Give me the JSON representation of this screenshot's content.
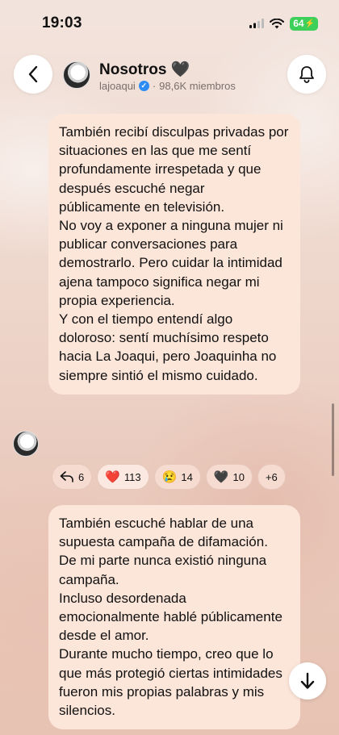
{
  "status_bar": {
    "time": "19:03",
    "battery": "64"
  },
  "header": {
    "title": "Nosotros",
    "title_emoji": "🖤",
    "creator": "lajoaqui",
    "separator": "·",
    "members": "98,6K miembros"
  },
  "messages": [
    {
      "paragraphs": [
        "También recibí disculpas privadas por situaciones en las que me sentí profundamente irrespetada y que después escuché negar públicamente en televisión.",
        "No voy a exponer a ninguna mujer ni publicar conversaciones para demostrarlo. Pero cuidar la intimidad ajena tampoco significa negar mi propia experiencia.",
        "Y con el tiempo entendí algo doloroso: sentí muchísimo respeto hacia La Joaqui, pero Joaquinha no siempre sintió el mismo cuidado."
      ]
    },
    {
      "paragraphs": [
        "También escuché hablar de una supuesta campaña de difamación.",
        "De mi parte nunca existió ninguna campaña.",
        "Incluso desordenada emocionalmente hablé públicamente desde el amor.",
        "Durante mucho tiempo, creo que lo que más protegió ciertas intimidades fueron mis propias palabras y mis silencios."
      ]
    }
  ],
  "reactions": [
    {
      "icon": "reply-icon",
      "glyph": "↶",
      "count": "6"
    },
    {
      "icon": "red-heart-emoji",
      "glyph": "❤️",
      "count": "113"
    },
    {
      "icon": "sad-face-emoji",
      "glyph": "😢",
      "count": "14"
    },
    {
      "icon": "black-heart-emoji",
      "glyph": "🖤",
      "count": "10"
    },
    {
      "icon": "more-reactions",
      "glyph": "",
      "count": "+6"
    }
  ],
  "colors": {
    "bubble": "#fce5d9",
    "verified": "#2f8cf5",
    "battery": "#3ccf5a"
  }
}
